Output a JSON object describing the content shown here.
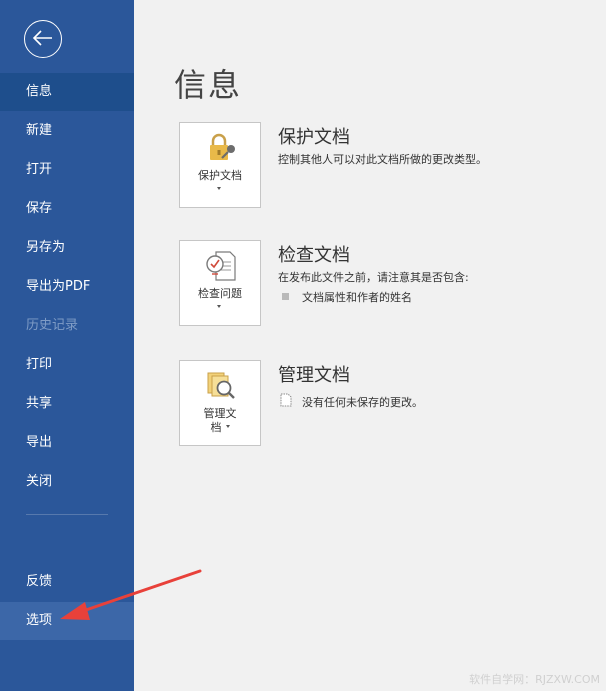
{
  "sidebar": {
    "items": [
      {
        "label": "信息"
      },
      {
        "label": "新建"
      },
      {
        "label": "打开"
      },
      {
        "label": "保存"
      },
      {
        "label": "另存为"
      },
      {
        "label": "导出为PDF"
      },
      {
        "label": "历史记录"
      },
      {
        "label": "打印"
      },
      {
        "label": "共享"
      },
      {
        "label": "导出"
      },
      {
        "label": "关闭"
      },
      {
        "label": "反馈"
      },
      {
        "label": "选项"
      }
    ]
  },
  "main": {
    "title": "信息",
    "protect": {
      "button_label": "保护文档",
      "title": "保护文档",
      "description": "控制其他人可以对此文档所做的更改类型。"
    },
    "inspect": {
      "button_label": "检查问题",
      "title": "检查文档",
      "description": "在发布此文件之前，请注意其是否包含:",
      "bullet": "文档属性和作者的姓名"
    },
    "manage": {
      "button_label_line1": "管理文",
      "button_label_line2": "档",
      "title": "管理文档",
      "description": "没有任何未保存的更改。"
    }
  },
  "annotation": {
    "arrow_color": "#e8413a"
  },
  "watermark": "软件自学网：RJZXW.COM",
  "colors": {
    "sidebar": "#2b579a",
    "active": "#1e4e8c",
    "background": "#f1f1f1"
  }
}
